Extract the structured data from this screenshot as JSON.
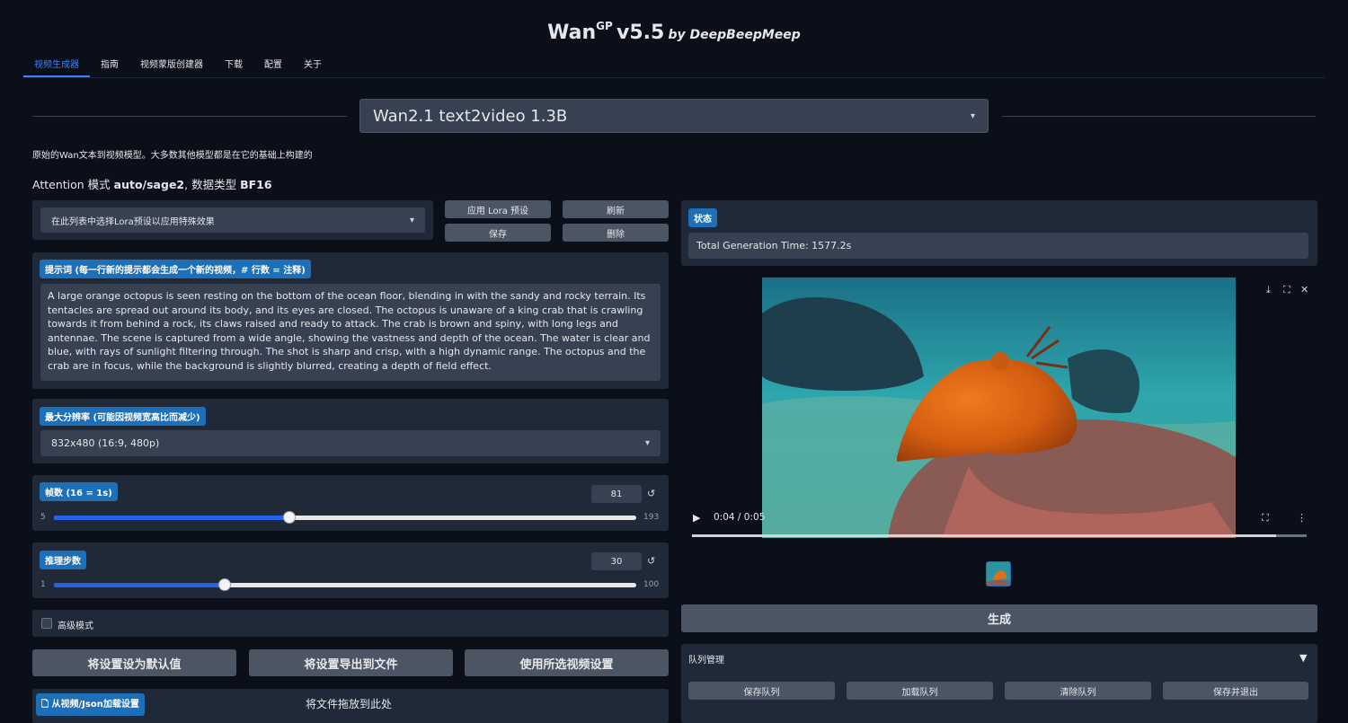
{
  "header": {
    "title_main": "Wan",
    "title_sup": "GP",
    "title_version": "v5.5",
    "title_by": "by DeepBeepMeep"
  },
  "tabs": [
    {
      "label": "视频生成器",
      "active": true
    },
    {
      "label": "指南"
    },
    {
      "label": "视频蒙版创建器"
    },
    {
      "label": "下载"
    },
    {
      "label": "配置"
    },
    {
      "label": "关于"
    }
  ],
  "model": {
    "selected": "Wan2.1 text2video 1.3B"
  },
  "model_description": "原始的Wan文本到视频模型。大多数其他模型都是在它的基础上构建的",
  "attention": {
    "prefix": "Attention 模式",
    "mode": "auto/sage2",
    "mid": ", 数据类型",
    "dtype": "BF16"
  },
  "lora": {
    "placeholder": "在此列表中选择Lora预设以应用特殊效果",
    "apply_label": "应用 Lora 预设",
    "refresh_label": "刷新",
    "save_label": "保存",
    "delete_label": "删除"
  },
  "prompt": {
    "label": "提示词 (每一行新的提示都会生成一个新的视频，# 行数 = 注释)",
    "value": "A large orange octopus is seen resting on the bottom of the ocean floor, blending in with the sandy and rocky terrain. Its tentacles are spread out around its body, and its eyes are closed. The octopus is unaware of a king crab that is crawling towards it from behind a rock, its claws raised and ready to attack. The crab is brown and spiny, with long legs and antennae. The scene is captured from a wide angle, showing the vastness and depth of the ocean. The water is clear and blue, with rays of sunlight filtering through. The shot is sharp and crisp, with a high dynamic range. The octopus and the crab are in focus, while the background is slightly blurred, creating a depth of field effect."
  },
  "resolution": {
    "label": "最大分辨率 (可能因视频宽高比而减少)",
    "value": "832x480 (16:9, 480p)"
  },
  "frames": {
    "label": "帧数 (16 = 1s)",
    "value": 81,
    "min": 5,
    "max": 193
  },
  "steps": {
    "label": "推理步数",
    "value": 30,
    "min": 1,
    "max": 100
  },
  "advanced": {
    "label": "高级模式",
    "checked": false
  },
  "actions": {
    "set_default": "将设置设为默认值",
    "export": "将设置导出到文件",
    "use_selected": "使用所选视频设置"
  },
  "load_settings": {
    "label": "从视频/Json加载设置",
    "drop_text": "将文件拖放到此处"
  },
  "status": {
    "label": "状态",
    "value": "Total Generation Time: 1577.2s"
  },
  "video": {
    "time": "0:04 / 0:05",
    "progress": 0.95
  },
  "generate_label": "生成",
  "queue": {
    "label": "队列管理",
    "save": "保存队列",
    "load": "加载队列",
    "clear": "清除队列",
    "save_exit": "保存并退出"
  },
  "icons": {
    "caret": "▾",
    "reset": "↺",
    "play": "▶",
    "download": "⤓",
    "fullscreen": "⛶",
    "close": "✕",
    "menu": "⋮",
    "collapse": "▼",
    "file": "🗋"
  }
}
